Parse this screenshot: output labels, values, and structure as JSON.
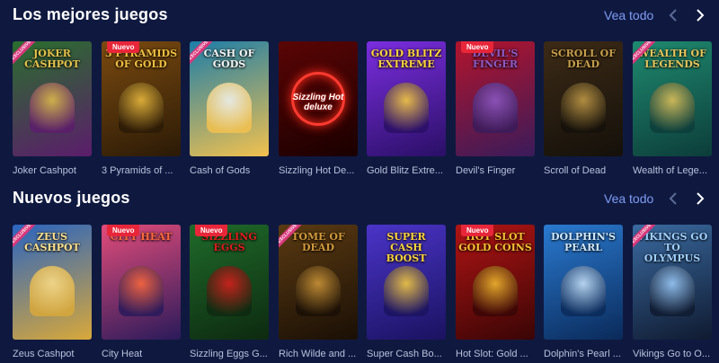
{
  "sections": [
    {
      "title": "Los mejores juegos",
      "see_all": "Vea todo",
      "games": [
        {
          "label": "Joker Cashpot",
          "art": "JOKER CASHPOT",
          "badge": "",
          "exclusive": true,
          "bg1": "#2a6e2e",
          "bg2": "#5b1d6b",
          "accent": "#e6c24a"
        },
        {
          "label": "3 Pyramids of ...",
          "art": "3 PYRAMIDS OF GOLD",
          "badge": "Nuevo",
          "exclusive": false,
          "bg1": "#7a4a10",
          "bg2": "#2b1a06",
          "accent": "#f1c040"
        },
        {
          "label": "Cash of Gods",
          "art": "CASH OF GODS",
          "badge": "",
          "exclusive": true,
          "bg1": "#1d7ea8",
          "bg2": "#f2c14e",
          "accent": "#f5f5f5"
        },
        {
          "label": "Sizzling Hot De...",
          "art": "",
          "badge": "",
          "exclusive": false,
          "bg1": "#5a0505",
          "bg2": "#1a0000",
          "accent": "#ff3b30"
        },
        {
          "label": "Gold Blitz Extre...",
          "art": "GOLD BLITZ EXTREME",
          "badge": "",
          "exclusive": false,
          "bg1": "#7b2ee0",
          "bg2": "#2a0f66",
          "accent": "#ffd43b"
        },
        {
          "label": "Devil's Finger",
          "art": "DEVIL'S FINGER",
          "badge": "Nuevo",
          "exclusive": false,
          "bg1": "#b2142c",
          "bg2": "#3a1b5a",
          "accent": "#8e5cc9"
        },
        {
          "label": "Scroll of Dead",
          "art": "SCROLL OF DEAD",
          "badge": "",
          "exclusive": false,
          "bg1": "#3c2a16",
          "bg2": "#14100a",
          "accent": "#c9a04a"
        },
        {
          "label": "Wealth of Lege...",
          "art": "WEALTH OF LEGENDS",
          "badge": "",
          "exclusive": true,
          "bg1": "#1f8a6f",
          "bg2": "#0c3d3a",
          "accent": "#e9c55a"
        }
      ]
    },
    {
      "title": "Nuevos juegos",
      "see_all": "Vea todo",
      "games": [
        {
          "label": "Zeus Cashpot",
          "art": "ZEUS CASHPOT",
          "badge": "",
          "exclusive": true,
          "bg1": "#2a64c0",
          "bg2": "#d8a83a",
          "accent": "#ffe08a"
        },
        {
          "label": "City Heat",
          "art": "CITY HEAT",
          "badge": "Nuevo",
          "exclusive": false,
          "bg1": "#e24c7a",
          "bg2": "#2a1a5a",
          "accent": "#ff6a3a"
        },
        {
          "label": "Sizzling Eggs G...",
          "art": "SIZZLING EGGS",
          "badge": "Nuevo",
          "exclusive": false,
          "bg1": "#1f6a2a",
          "bg2": "#0d2a10",
          "accent": "#e01c1c"
        },
        {
          "label": "Rich Wilde and ...",
          "art": "TOME OF DEAD",
          "badge": "",
          "exclusive": true,
          "bg1": "#5a3a12",
          "bg2": "#1a0f05",
          "accent": "#d39a3a"
        },
        {
          "label": "Super Cash Bo...",
          "art": "SUPER CASH BOOST",
          "badge": "",
          "exclusive": false,
          "bg1": "#4a34c8",
          "bg2": "#1a1260",
          "accent": "#ffd43b"
        },
        {
          "label": "Hot Slot: Gold ...",
          "art": "HOT SLOT GOLD COINS",
          "badge": "Nuevo",
          "exclusive": false,
          "bg1": "#b01414",
          "bg2": "#3a0505",
          "accent": "#f5c030"
        },
        {
          "label": "Dolphin's Pearl ...",
          "art": "DOLPHIN'S PEARL",
          "badge": "",
          "exclusive": false,
          "bg1": "#2a7ad0",
          "bg2": "#0a2a5a",
          "accent": "#cfe9ff"
        },
        {
          "label": "Vikings Go to O...",
          "art": "VIKINGS GO TO OLYMPUS",
          "badge": "",
          "exclusive": true,
          "bg1": "#3a6aa0",
          "bg2": "#0f1a30",
          "accent": "#9fd0ff"
        }
      ]
    }
  ],
  "exclusive_text": "EXCLUSIVE",
  "sizzling_text": "Sizzling Hot deluxe",
  "colors": {
    "page_bg": "#0f1940",
    "link": "#7f9cf5",
    "badge": "#e8263a",
    "label": "#b7c0db"
  },
  "icons": {
    "prev": "chevron-left-icon",
    "next": "chevron-right-icon"
  }
}
